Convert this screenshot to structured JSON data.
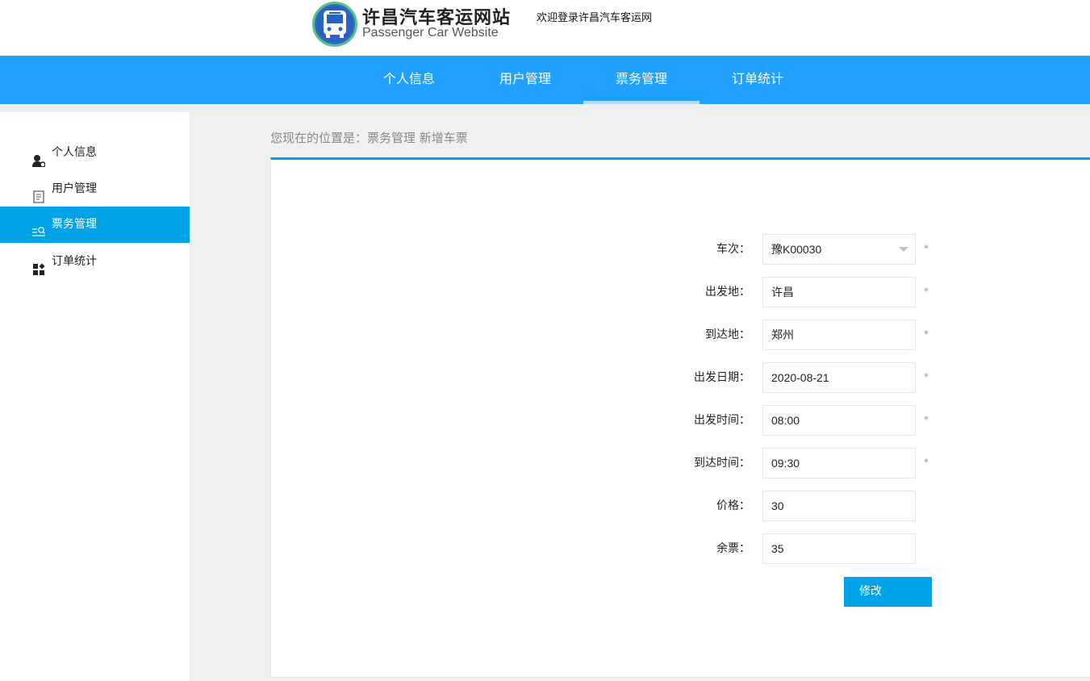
{
  "header": {
    "title": "许昌汽车客运网站",
    "subtitle": "Passenger Car Website",
    "welcome": "欢迎登录许昌汽车客运网",
    "logo_icon": "bus-icon"
  },
  "topnav": {
    "items": [
      {
        "label": "个人信息"
      },
      {
        "label": "用户管理"
      },
      {
        "label": "票务管理",
        "active": true
      },
      {
        "label": "订单统计"
      }
    ]
  },
  "sidebar": {
    "items": [
      {
        "label": "个人信息",
        "icon": "user-icon"
      },
      {
        "label": "用户管理",
        "icon": "document-icon"
      },
      {
        "label": "票务管理",
        "icon": "search-list-icon",
        "active": true
      },
      {
        "label": "订单统计",
        "icon": "grid-icon"
      }
    ]
  },
  "breadcrumb": "您现在的位置是：票务管理 新增车票",
  "form": {
    "fields": [
      {
        "label": "车次：",
        "value": "豫K00030",
        "type": "select",
        "required": "*"
      },
      {
        "label": "出发地：",
        "value": "许昌",
        "required": "*"
      },
      {
        "label": "到达地：",
        "value": "郑州",
        "required": "*"
      },
      {
        "label": "出发日期：",
        "value": "2020-08-21",
        "required": "*"
      },
      {
        "label": "出发时间：",
        "value": "08:00",
        "required": "*"
      },
      {
        "label": "到达时间：",
        "value": "09:30",
        "required": "*"
      },
      {
        "label": "价格：",
        "value": "30"
      },
      {
        "label": "余票：",
        "value": "35"
      }
    ],
    "submit_label": "修改"
  },
  "colors": {
    "nav": "#20a0ff",
    "accent": "#00a2e8"
  }
}
